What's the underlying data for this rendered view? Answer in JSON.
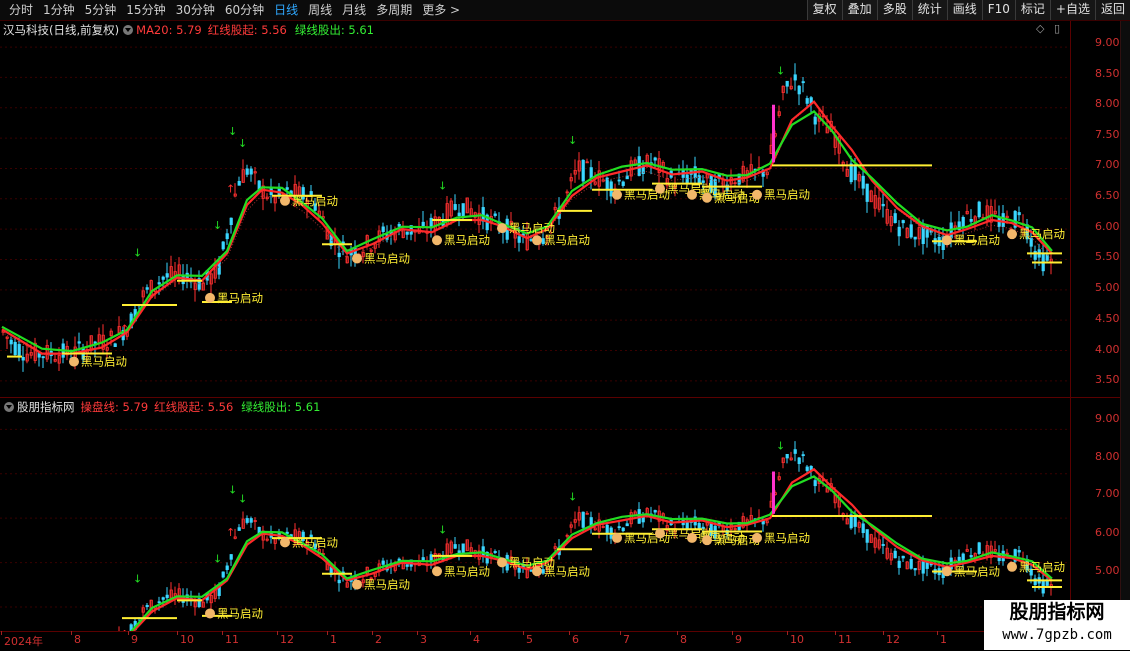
{
  "toolbar": {
    "periods": [
      "分时",
      "1分钟",
      "5分钟",
      "15分钟",
      "30分钟",
      "60分钟",
      "日线",
      "周线",
      "月线",
      "多周期",
      "更多 >"
    ],
    "active_period": "日线",
    "buttons": [
      "复权",
      "叠加",
      "多股",
      "统计",
      "画线",
      "F10",
      "标记",
      "+自选",
      "返回"
    ]
  },
  "top_panel": {
    "title": "汉马科技(日线,前复权)",
    "ma_label": "MA20: 5.79",
    "red_label": "红线股起: 5.56",
    "green_label": "绿线股出: 5.61",
    "ticks": [
      "9.00",
      "8.50",
      "8.00",
      "7.50",
      "7.00",
      "6.50",
      "6.00",
      "5.50",
      "5.00",
      "4.50",
      "4.00",
      "3.50"
    ]
  },
  "bottom_panel": {
    "title": "股朋指标网",
    "op_label": "操盘线: 5.79",
    "red_label": "红线股起: 5.56",
    "green_label": "绿线股出: 5.61",
    "ticks": [
      "9.00",
      "8.00",
      "7.00",
      "6.00",
      "5.00"
    ]
  },
  "x_axis": {
    "labels": [
      "2024年",
      "8",
      "9",
      "10",
      "11",
      "12",
      "1",
      "2",
      "3",
      "4",
      "5",
      "6",
      "7",
      "8",
      "9",
      "10",
      "11",
      "12",
      "1"
    ]
  },
  "signal_label": "黑马启动",
  "watermark": {
    "line1": "股朋指标网",
    "line2": "www.7gpzb.com"
  },
  "colors": {
    "red_line": "#ff2a2a",
    "green_line": "#22dd22",
    "yellow_line": "#ffee33",
    "up": "#ff3030",
    "down": "#3ad6ff",
    "ma_dot": "#a03030",
    "magenta": "#ff33cc"
  },
  "chart_data": {
    "type": "line",
    "x": [
      "2024年",
      "8",
      "9",
      "10",
      "11",
      "12",
      "1",
      "2",
      "3",
      "4",
      "5",
      "6",
      "7",
      "8",
      "9",
      "10",
      "11",
      "12",
      "1"
    ],
    "series": [
      {
        "name": "红线股起",
        "values": [
          3.85,
          3.9,
          4.3,
          4.8,
          5.2,
          5.1,
          6.6,
          6.4,
          5.9,
          5.7,
          6.0,
          6.2,
          6.0,
          6.1,
          6.6,
          7.0,
          6.9,
          6.8,
          7.0,
          8.1,
          7.6,
          6.8,
          6.1,
          5.9,
          6.1,
          5.8,
          5.56
        ]
      },
      {
        "name": "绿线股出",
        "values": [
          3.9,
          4.0,
          4.5,
          5.0,
          5.25,
          5.15,
          6.7,
          6.5,
          6.0,
          5.8,
          6.1,
          6.3,
          6.0,
          6.2,
          6.7,
          7.05,
          6.95,
          6.85,
          7.05,
          8.1,
          7.4,
          6.6,
          6.0,
          5.95,
          6.2,
          6.0,
          5.61
        ]
      }
    ],
    "ma_label": "MA20",
    "ma_value": 5.79,
    "ylim": [
      3.3,
      9.2
    ],
    "signals": 16
  }
}
